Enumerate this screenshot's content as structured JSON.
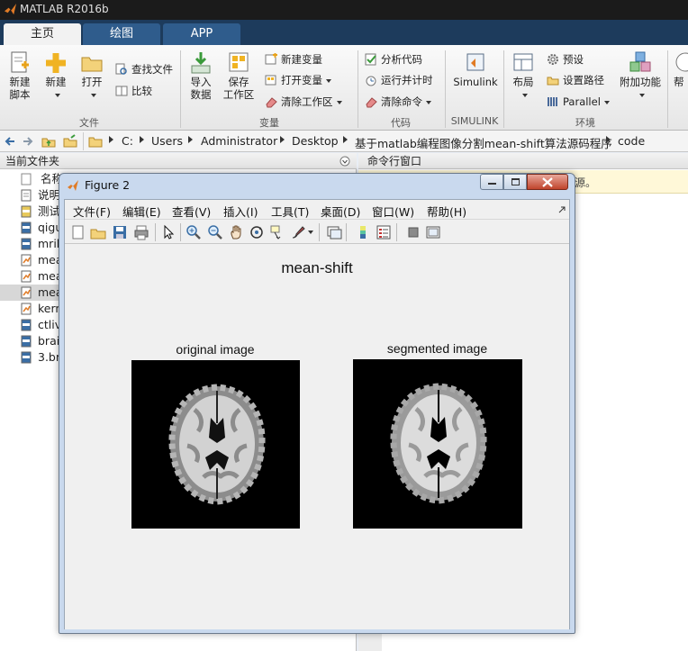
{
  "app": {
    "title": "MATLAB R2016b"
  },
  "tabs": [
    {
      "label": "主页",
      "active": true
    },
    {
      "label": "绘图",
      "active": false
    },
    {
      "label": "APP",
      "active": false
    }
  ],
  "ribbon": {
    "file_group": {
      "label": "文件",
      "new_script": [
        "新建",
        "脚本"
      ],
      "new": "新建",
      "open": "打开",
      "find_files": "查找文件",
      "compare": "比较"
    },
    "variable_group": {
      "label": "变量",
      "import_data": [
        "导入",
        "数据"
      ],
      "save_workspace": [
        "保存",
        "工作区"
      ],
      "new_variable": "新建变量",
      "open_variable": "打开变量",
      "clear_workspace": "清除工作区"
    },
    "code_group": {
      "label": "代码",
      "analyze_code": "分析代码",
      "run_and_time": "运行并计时",
      "clear_commands": "清除命令"
    },
    "simulink_group": {
      "label": "SIMULINK",
      "simulink": "Simulink"
    },
    "environment_group": {
      "label": "环境",
      "layout": "布局",
      "preferences": "预设",
      "set_path": "设置路径",
      "parallel": "Parallel",
      "addons": "附加功能"
    },
    "help_partial": "帮"
  },
  "address_bar": {
    "path": [
      "C:",
      "Users",
      "Administrator",
      "Desktop",
      "基于matlab编程图像分割mean-shift算法源码程序",
      "code"
    ]
  },
  "current_folder": {
    "title": "当前文件夹",
    "column_name": "名称",
    "files": [
      {
        "name": "说明",
        "type": "txt"
      },
      {
        "name": "测试",
        "type": "tif"
      },
      {
        "name": "qigu",
        "type": "bmp"
      },
      {
        "name": "mrib",
        "type": "bmp"
      },
      {
        "name": "mea",
        "type": "m"
      },
      {
        "name": "mea",
        "type": "m"
      },
      {
        "name": "mea",
        "type": "m",
        "selected": true
      },
      {
        "name": "kern",
        "type": "m"
      },
      {
        "name": "ctlivi",
        "type": "bmp"
      },
      {
        "name": "brai",
        "type": "bmp"
      },
      {
        "name": "3.bm",
        "type": "bmp"
      }
    ]
  },
  "command_window": {
    "title": "命令行窗口",
    "notice_tail": "源。"
  },
  "figure": {
    "window_title": "Figure 2",
    "menu": [
      "文件(F)",
      "编辑(E)",
      "查看(V)",
      "插入(I)",
      "工具(T)",
      "桌面(D)",
      "窗口(W)",
      "帮助(H)"
    ],
    "suptitle": "mean-shift",
    "subplots": [
      {
        "title": "original image"
      },
      {
        "title": "segmented image"
      }
    ]
  },
  "colors": {
    "tabstrip": "#1d3b5c",
    "tab_inactive": "#2f5c8c",
    "figure_frame": "#c9d9ee",
    "figure_bg": "#f0f0f0",
    "image_bg": "#000000",
    "brain_gray": "#9a9a9a",
    "brain_white": "#dcdcdc"
  }
}
